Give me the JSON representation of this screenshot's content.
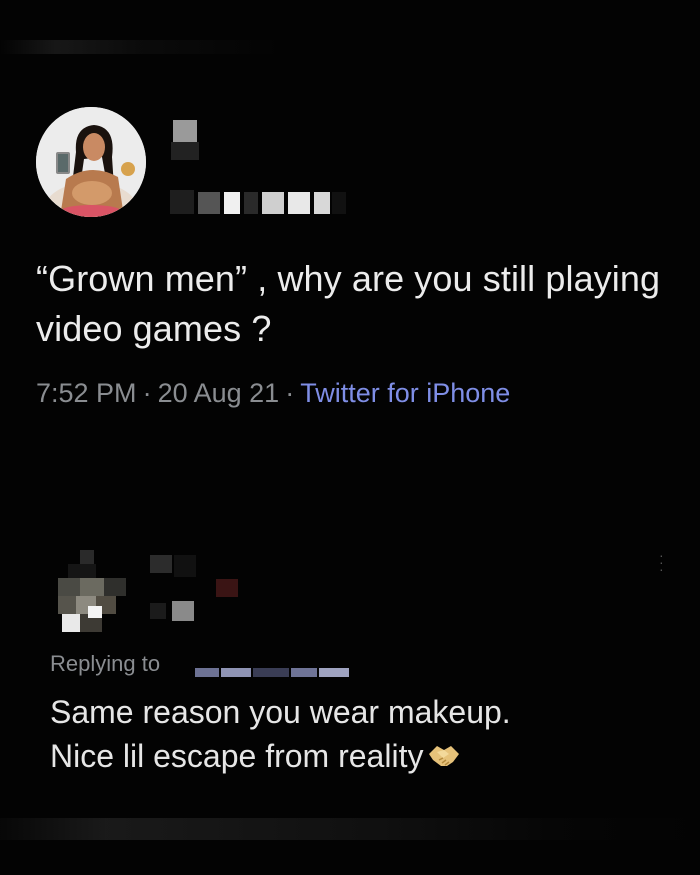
{
  "tweet": {
    "text": "“Grown men” , why are you still playing video games ?",
    "time": "7:52 PM",
    "date": "20 Aug 21",
    "separator": "·",
    "source": "Twitter for iPhone"
  },
  "reply": {
    "replying_to_label": "Replying to",
    "text_line1": "Same reason you wear makeup.",
    "text_line2": "Nice lil escape from reality",
    "emoji_icon": "handshake-icon"
  },
  "colors": {
    "background": "#030303",
    "text": "#ececec",
    "meta_text": "#8a8d91",
    "link": "#7f8ee6"
  }
}
